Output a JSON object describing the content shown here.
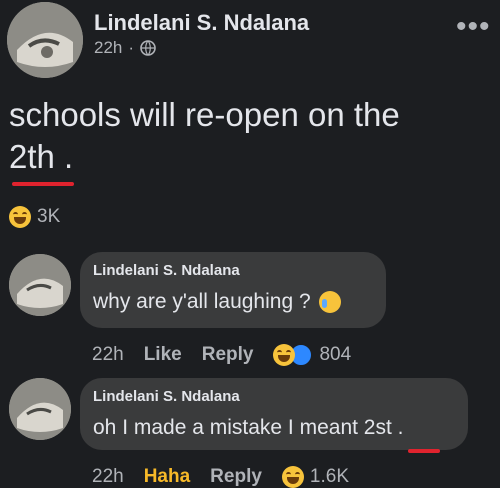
{
  "post": {
    "author": "Lindelani S. Ndalana",
    "time": "22h",
    "separator": "·",
    "audience_icon": "globe-icon",
    "more_label": "•••",
    "text_line1": "schools will re-open on the",
    "text_line2": "2th .",
    "reaction_count": "3K",
    "reaction_icon": "haha-emoji-icon"
  },
  "comments": [
    {
      "author": "Lindelani S. Ndalana",
      "text": "why are y'all laughing ?",
      "time": "22h",
      "like_label": "Like",
      "reply_label": "Reply",
      "reaction_count": "804"
    },
    {
      "author": "Lindelani S. Ndalana",
      "text": "oh I made a mistake I meant 2st .",
      "time": "22h",
      "like_label": "Haha",
      "reply_label": "Reply",
      "reaction_count": "1.6K"
    }
  ],
  "colors": {
    "background": "#1c1e21",
    "bubble": "#3a3b3c",
    "underline": "#e0232e",
    "haha": "#f7b928"
  }
}
